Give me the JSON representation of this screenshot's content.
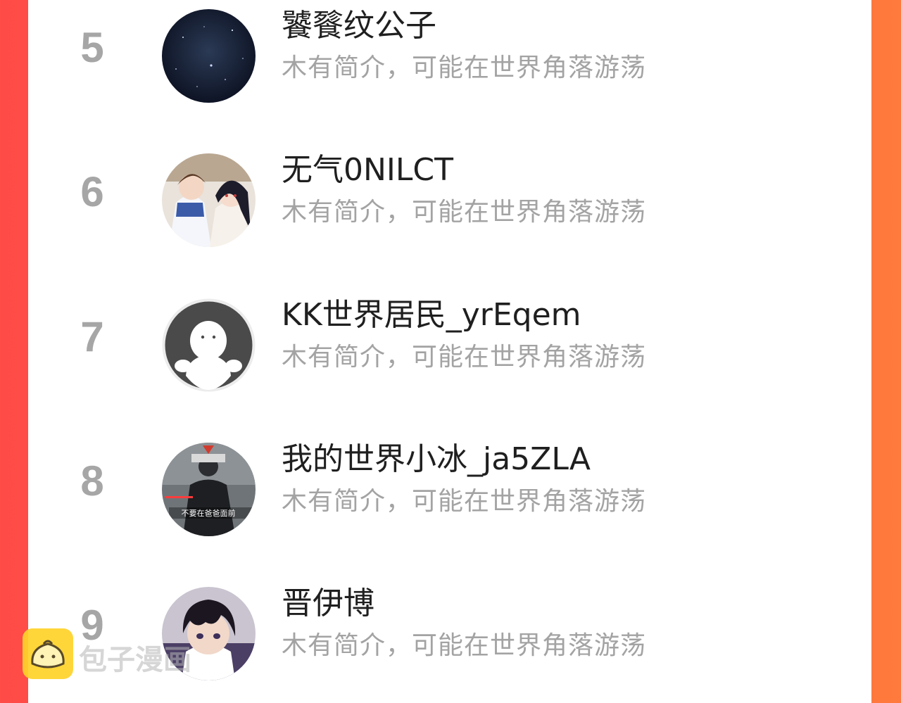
{
  "ranking": {
    "rows": [
      {
        "rank": "5",
        "name": "饕餮纹公子",
        "bio": "木有简介，可能在世界角落游荡",
        "avatar": "starry-night-avatar"
      },
      {
        "rank": "6",
        "name": "无气0NILCT",
        "bio": "木有简介，可能在世界角落游荡",
        "avatar": "anime-couple-avatar"
      },
      {
        "rank": "7",
        "name": "KK世界居民_yrEqem",
        "bio": "木有简介，可能在世界角落游荡",
        "avatar": "default-ghost-avatar"
      },
      {
        "rank": "8",
        "name": "我的世界小冰_ja5ZLA",
        "bio": "木有简介，可能在世界角落游荡",
        "avatar": "meme-avatar",
        "avatar_text": "不要在爸爸面前"
      },
      {
        "rank": "9",
        "name": "晋伊博",
        "bio": "木有简介，可能在世界角落游荡",
        "avatar": "anime-boy-avatar"
      }
    ]
  },
  "watermark": {
    "text": "包子漫画",
    "icon": "bun-logo-icon"
  },
  "colors": {
    "background_left": "#ff4b47",
    "background_right": "#ff7a3c",
    "rank": "#a6a6a6",
    "name": "#1f1f1f",
    "bio": "#a3a3a3"
  }
}
